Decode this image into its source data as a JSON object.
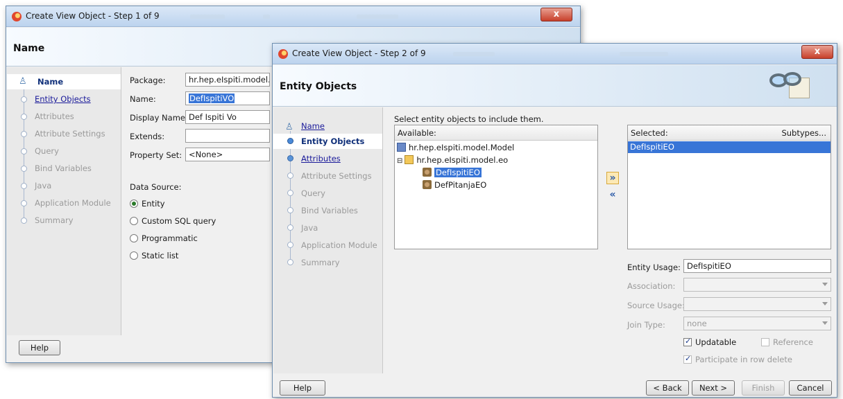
{
  "window1": {
    "title": "Create View Object - Step 1 of 9",
    "header": "Name",
    "nav": [
      "Name",
      "Entity Objects",
      "Attributes",
      "Attribute Settings",
      "Query",
      "Bind Variables",
      "Java",
      "Application Module",
      "Summary"
    ],
    "form": {
      "package_label": "Package:",
      "package_value": "hr.hep.eIspiti.model.vo",
      "name_label": "Name:",
      "name_value": "DefIspitiVO",
      "display_name_label": "Display Name:",
      "display_name_value": "Def Ispiti Vo",
      "extends_label": "Extends:",
      "extends_value": "",
      "property_set_label": "Property Set:",
      "property_set_value": "<None>",
      "data_source_label": "Data Source:",
      "options": [
        "Entity",
        "Custom SQL query",
        "Programmatic",
        "Static list"
      ]
    },
    "help": "Help"
  },
  "window2": {
    "title": "Create View Object - Step 2 of 9",
    "header": "Entity Objects",
    "close": "x",
    "nav": [
      "Name",
      "Entity Objects",
      "Attributes",
      "Attribute Settings",
      "Query",
      "Bind Variables",
      "Java",
      "Application Module",
      "Summary"
    ],
    "instruction": "Select entity objects to include them.",
    "available_label": "Available:",
    "tree": {
      "root": "hr.hep.eIspiti.model.Model",
      "pkg": "hr.hep.eIspiti.model.eo",
      "items": [
        "DefIspitiEO",
        "DefPitanjaEO"
      ]
    },
    "selected_label": "Selected:",
    "subtypes_label": "Subtypes...",
    "selected_items": [
      "DefIspitiEO"
    ],
    "entity_usage_label": "Entity Usage:",
    "entity_usage_value": "DefIspitiEO",
    "association_label": "Association:",
    "source_usage_label": "Source Usage:",
    "join_type_label": "Join Type:",
    "join_type_value": "none",
    "updatable": "Updatable",
    "reference": "Reference",
    "participate": "Participate in row delete",
    "buttons": {
      "help": "Help",
      "back": "< Back",
      "next": "Next >",
      "finish": "Finish",
      "cancel": "Cancel"
    }
  }
}
